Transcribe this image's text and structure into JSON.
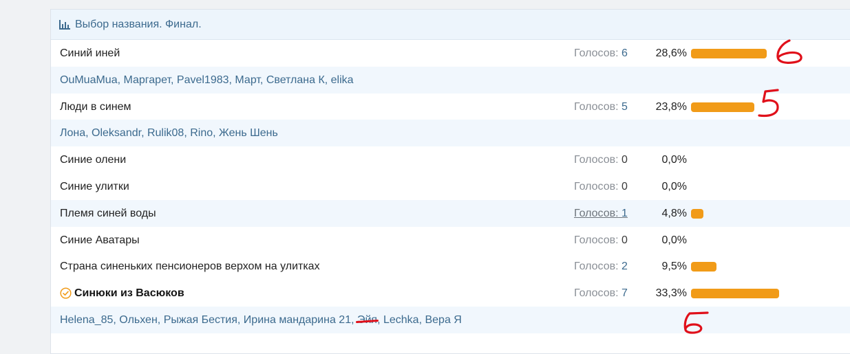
{
  "poll": {
    "title": "Выбор названия. Финал.",
    "votes_prefix": "Голосов:",
    "options": [
      {
        "label": "Синий иней",
        "votes": "6",
        "percent": "28,6%",
        "fraction": 0.286
      },
      {
        "label": "Люди в синем",
        "votes": "5",
        "percent": "23,8%",
        "fraction": 0.238
      },
      {
        "label": "Синие олени",
        "votes": "0",
        "percent": "0,0%",
        "fraction": 0
      },
      {
        "label": "Синие улитки",
        "votes": "0",
        "percent": "0,0%",
        "fraction": 0
      },
      {
        "label": "Племя синей воды",
        "votes": "1",
        "percent": "4,8%",
        "fraction": 0.048
      },
      {
        "label": "Синие Аватары",
        "votes": "0",
        "percent": "0,0%",
        "fraction": 0
      },
      {
        "label": "Страна синеньких пенсионеров верхом на улитках",
        "votes": "2",
        "percent": "9,5%",
        "fraction": 0.095
      },
      {
        "label": "Синюки из Васюков",
        "votes": "7",
        "percent": "33,3%",
        "fraction": 0.333
      }
    ],
    "voters_1": [
      "OuMuaMua",
      "Маргарет",
      "Pavel1983",
      "Март",
      "Светлана К",
      "elika"
    ],
    "voters_2": [
      "Лона",
      "Oleksandr",
      "Rulik08",
      "Rino",
      "Жень Шень"
    ],
    "voters_3": [
      "Helena_85",
      "Ольхен",
      "Рыжая Бестия",
      "Ирина мандарина 21",
      "Эйя",
      "Lechka",
      "Вера Я"
    ],
    "separator": ", "
  },
  "annotations": {
    "mark_1": "6",
    "mark_2": "5",
    "mark_3": "6"
  },
  "colors": {
    "bar": "#f19b18",
    "link": "#3c6a8e",
    "header_bg": "#edf5fc",
    "alt_row_bg": "#f1f7fd",
    "annotation": "#e0101a",
    "winner_check": "#f19b18"
  }
}
